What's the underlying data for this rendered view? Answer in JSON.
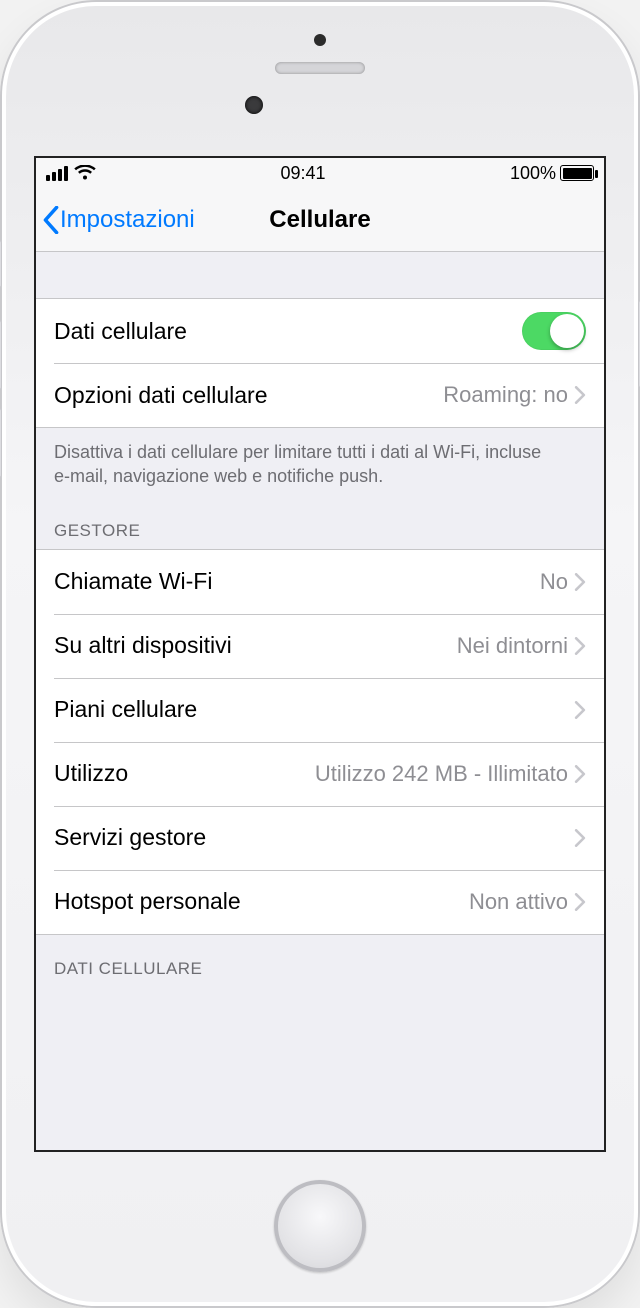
{
  "status": {
    "time": "09:41",
    "battery": "100%"
  },
  "nav": {
    "back": "Impostazioni",
    "title": "Cellulare"
  },
  "section1": {
    "cellular_data": "Dati cellulare",
    "options_label": "Opzioni dati cellulare",
    "options_value": "Roaming: no",
    "footer": "Disattiva i dati cellulare per limitare tutti i dati al Wi‑Fi, incluse e‑mail, navigazione web e notifiche push."
  },
  "carrier_header": "GESTORE",
  "carrier": {
    "wifi_calls_label": "Chiamate Wi-Fi",
    "wifi_calls_value": "No",
    "other_devices_label": "Su altri dispositivi",
    "other_devices_value": "Nei dintorni",
    "plans_label": "Piani cellulare",
    "usage_label": "Utilizzo",
    "usage_value": "Utilizzo 242 MB - Illimitato",
    "carrier_services_label": "Servizi gestore",
    "hotspot_label": "Hotspot personale",
    "hotspot_value": "Non attivo"
  },
  "cellular_data_header": "DATI CELLULARE"
}
